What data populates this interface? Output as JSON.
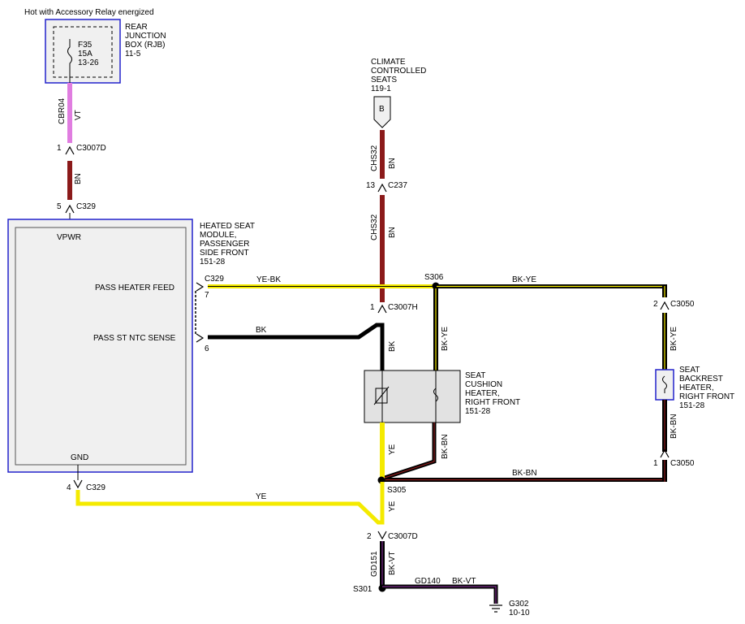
{
  "header": {
    "power_note": "Hot with Accessory Relay energized"
  },
  "rjb": {
    "name_lines": [
      "REAR",
      "JUNCTION",
      "BOX (RJB)",
      "11-5"
    ],
    "fuse_lines": [
      "F35",
      "15A",
      "13-26"
    ]
  },
  "module": {
    "name_lines": [
      "HEATED SEAT",
      "MODULE,",
      "PASSENGER",
      "SIDE FRONT",
      "151-28"
    ],
    "pin_vpwr": "VPWR",
    "pin_feed": "PASS HEATER FEED",
    "pin_ntc": "PASS ST NTC SENSE",
    "pin_gnd": "GND"
  },
  "climate": {
    "name_lines": [
      "CLIMATE",
      "CONTROLLED",
      "SEATS",
      "119-1"
    ],
    "connector": "B"
  },
  "cushion": {
    "name_lines": [
      "SEAT",
      "CUSHION",
      "HEATER,",
      "RIGHT FRONT",
      "151-28"
    ]
  },
  "backrest": {
    "name_lines": [
      "SEAT",
      "BACKREST",
      "HEATER,",
      "RIGHT FRONT",
      "151-28"
    ]
  },
  "ground": {
    "name": "G302",
    "ref": "10-10"
  },
  "circuits": {
    "cbr04": "CBR04",
    "vt": "VT",
    "bn": "BN",
    "chs32": "CHS32",
    "ye_bk": "YE-BK",
    "bk_ye": "BK-YE",
    "bk": "BK",
    "ye": "YE",
    "bk_bn": "BK-BN",
    "gd151": "GD151",
    "bk_vt": "BK-VT",
    "gd140": "GD140"
  },
  "connectors": {
    "c3007d": "C3007D",
    "c329": "C329",
    "c237": "C237",
    "c3007h": "C3007H",
    "c3050": "C3050"
  },
  "pins": {
    "p1": "1",
    "p5": "5",
    "p13": "13",
    "p7": "7",
    "p6": "6",
    "p2": "2",
    "p4": "4"
  },
  "splices": {
    "s306": "S306",
    "s305": "S305",
    "s301": "S301"
  },
  "colors": {
    "violet": "#e07de0",
    "brown": "#8b1a1a",
    "yellow": "#f4ea00",
    "black": "#000000",
    "module_border": "#2222cc",
    "module_fill": "#f0f0f0",
    "component_fill": "#e2e2e2"
  }
}
